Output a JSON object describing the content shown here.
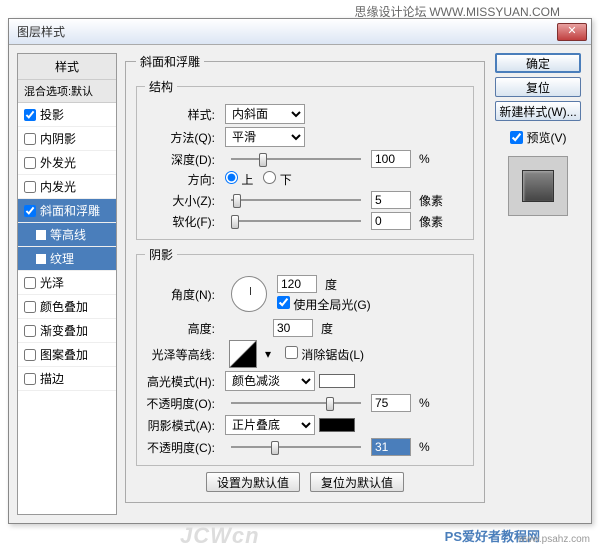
{
  "header": {
    "site": "思缘设计论坛",
    "url": "WWW.MISSYUAN.COM"
  },
  "dialog": {
    "title": "图层样式"
  },
  "sidebar": {
    "header": "样式",
    "blend": "混合选项:默认",
    "items": [
      {
        "label": "投影",
        "checked": true
      },
      {
        "label": "内阴影",
        "checked": false
      },
      {
        "label": "外发光",
        "checked": false
      },
      {
        "label": "内发光",
        "checked": false
      },
      {
        "label": "斜面和浮雕",
        "checked": true,
        "selected": true
      },
      {
        "label": "光泽",
        "checked": false
      },
      {
        "label": "颜色叠加",
        "checked": false
      },
      {
        "label": "渐变叠加",
        "checked": false
      },
      {
        "label": "图案叠加",
        "checked": false
      },
      {
        "label": "描边",
        "checked": false
      }
    ],
    "subs": [
      {
        "label": "等高线"
      },
      {
        "label": "纹理"
      }
    ]
  },
  "main": {
    "title": "斜面和浮雕",
    "structure": {
      "legend": "结构",
      "style_label": "样式:",
      "style_value": "内斜面",
      "technique_label": "方法(Q):",
      "technique_value": "平滑",
      "depth_label": "深度(D):",
      "depth_value": "100",
      "direction_label": "方向:",
      "dir_up": "上",
      "dir_down": "下",
      "size_label": "大小(Z):",
      "size_value": "5",
      "soften_label": "软化(F):",
      "soften_value": "0",
      "px": "像素",
      "pct": "%"
    },
    "shading": {
      "legend": "阴影",
      "angle_label": "角度(N):",
      "angle_value": "120",
      "global_label": "使用全局光(G)",
      "altitude_label": "高度:",
      "altitude_value": "30",
      "deg": "度",
      "contour_label": "光泽等高线:",
      "antialias_label": "消除锯齿(L)",
      "highlight_mode_label": "高光模式(H):",
      "highlight_mode_value": "颜色减淡",
      "opacity_label": "不透明度(O):",
      "highlight_opacity": "75",
      "shadow_mode_label": "阴影模式(A):",
      "shadow_mode_value": "正片叠底",
      "shadow_opacity_label": "不透明度(C):",
      "shadow_opacity": "31",
      "pct": "%"
    },
    "buttons": {
      "set_default": "设置为默认值",
      "reset_default": "复位为默认值"
    }
  },
  "right": {
    "ok": "确定",
    "cancel": "复位",
    "new_style": "新建样式(W)...",
    "preview": "预览(V)"
  },
  "footer": {
    "text1": "PS爱好者教程网",
    "text2": "www.psahz.com"
  },
  "watermark": "JCWcn"
}
